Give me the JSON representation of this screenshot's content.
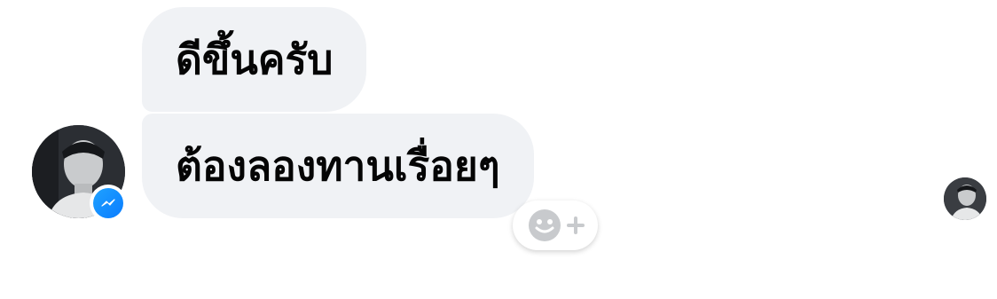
{
  "messages": [
    {
      "text": "ดีขึ้นครับ"
    },
    {
      "text": "ต้องลองทานเรื่อยๆ"
    }
  ],
  "icons": {
    "sender_avatar": "avatar",
    "platform_badge": "messenger-icon",
    "reaction": "smiley-plus-icon",
    "seen_indicator": "read-receipt-avatar"
  },
  "colors": {
    "bubble_background": "#f0f2f5",
    "text": "#050505",
    "messenger_blue": "#0a7cff"
  }
}
